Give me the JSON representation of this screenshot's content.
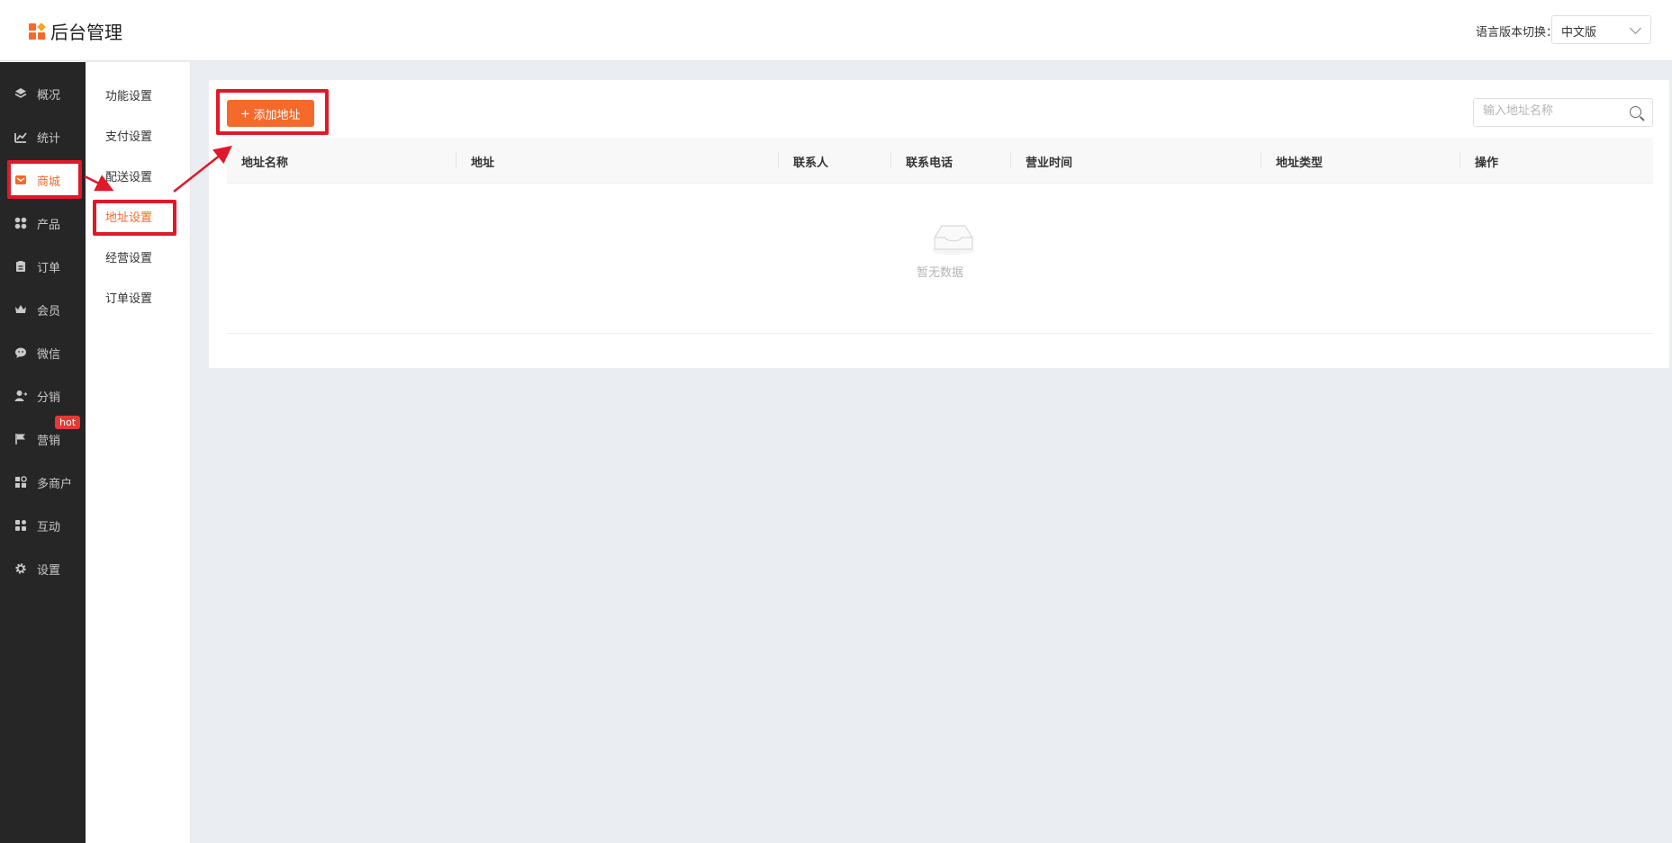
{
  "header": {
    "title": "后台管理",
    "language_label": "语言版本切换：",
    "language_value": "中文版"
  },
  "sidebar": {
    "items": [
      {
        "label": "概况",
        "icon": "layers-icon"
      },
      {
        "label": "统计",
        "icon": "chart-icon"
      },
      {
        "label": "商城",
        "icon": "mail-icon"
      },
      {
        "label": "产品",
        "icon": "apps-icon"
      },
      {
        "label": "订单",
        "icon": "clipboard-icon"
      },
      {
        "label": "会员",
        "icon": "crown-icon"
      },
      {
        "label": "微信",
        "icon": "wechat-icon"
      },
      {
        "label": "分销",
        "icon": "user-share-icon"
      },
      {
        "label": "营销",
        "icon": "flag-icon"
      },
      {
        "label": "多商户",
        "icon": "store-icon"
      },
      {
        "label": "互动",
        "icon": "grid-icon"
      },
      {
        "label": "设置",
        "icon": "gear-icon"
      }
    ],
    "active": "商城",
    "hot_badge": "hot"
  },
  "subnav": {
    "items": [
      "功能设置",
      "支付设置",
      "配送设置",
      "地址设置",
      "经营设置",
      "订单设置"
    ],
    "active": "地址设置"
  },
  "toolbar": {
    "add_label": "添加地址",
    "search_placeholder": "输入地址名称"
  },
  "table": {
    "columns": [
      "地址名称",
      "地址",
      "联系人",
      "联系电话",
      "营业时间",
      "地址类型",
      "操作"
    ],
    "empty_text": "暂无数据"
  },
  "colors": {
    "accent": "#f5692b",
    "sidebar_bg": "#262626",
    "highlight": "#e0192a"
  }
}
